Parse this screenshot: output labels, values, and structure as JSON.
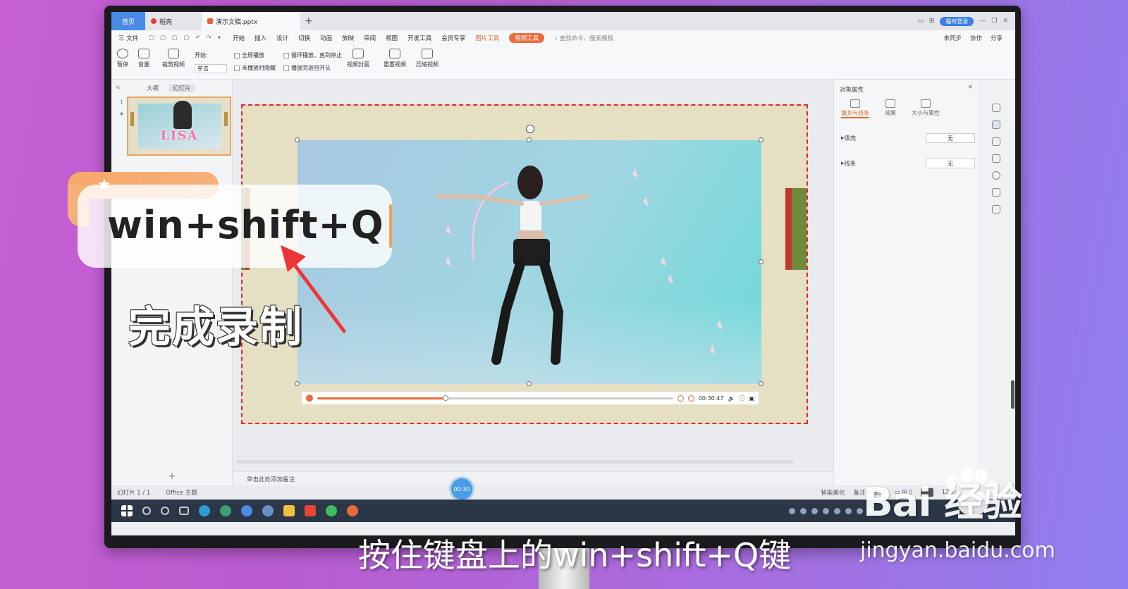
{
  "tabbar": {
    "home": "首页",
    "docer": "稻壳",
    "file_tab": "演示文稿.pptx",
    "login": "临时登录"
  },
  "menu": {
    "file": "三 文件",
    "items": [
      "开始",
      "插入",
      "设计",
      "切换",
      "动画",
      "放映",
      "审阅",
      "视图",
      "开发工具",
      "会员专享"
    ],
    "picture_tools": "图片工具",
    "video_tools": "视频工具",
    "search": "查找命令、搜索模板",
    "sync": "未同步",
    "collab": "协作",
    "share": "分享"
  },
  "ribbon": {
    "pause": "暂停",
    "volume": "音量",
    "trim": "裁剪视频",
    "start_label": "开始:",
    "start_value": "单击",
    "fullscreen": "全屏播放",
    "hide_not_playing": "未播放时隐藏",
    "loop": "循环播放，直到停止",
    "rewind": "播放完返回开头",
    "cover": "视频封面",
    "reset": "重置视频",
    "compress": "压缩视频"
  },
  "left_panel": {
    "tab_outline": "大纲",
    "tab_slides": "幻灯片",
    "slide_number": "1",
    "thumb_text": "LISA",
    "add": "+"
  },
  "player": {
    "time": "00:30.47",
    "progress": 0.36
  },
  "notes": "单击此处添加备注",
  "right_panel": {
    "title": "对象属性",
    "tabs": [
      "填充与线条",
      "效果",
      "大小与属性"
    ],
    "fill_label": "填充",
    "fill_value": "无",
    "line_label": "线条",
    "line_value": "无"
  },
  "status": {
    "slide": "幻灯片 1 / 1",
    "theme": "Office 主题",
    "beautify": "智能美化",
    "notes": "备注",
    "comments": "批注",
    "zoom": "128%"
  },
  "recording_timer": "00:30",
  "overlay": {
    "shortcut": "win+shift+Q",
    "done": "完成录制",
    "subtitle": "按住键盘上的win+shift+Q键"
  },
  "watermark": {
    "logo": "Bai 经验",
    "url": "jingyan.baidu.com"
  },
  "colors": {
    "accent_orange": "#ee6b3e",
    "selection_dash": "#e8262e",
    "home_tab_blue": "#4a8be8"
  }
}
